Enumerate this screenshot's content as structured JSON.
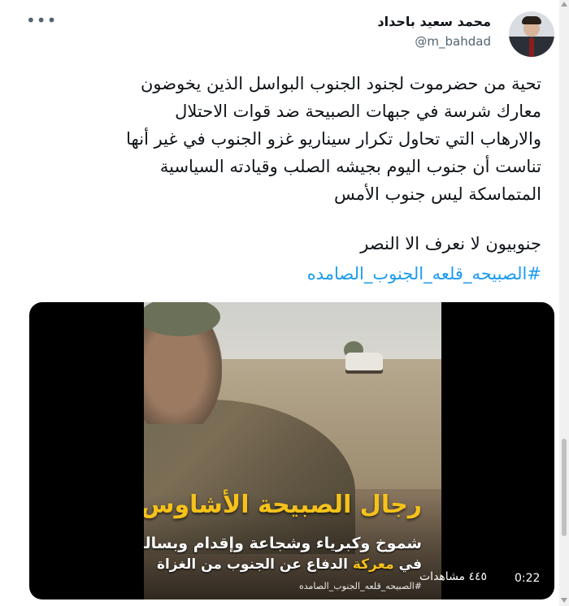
{
  "tweet": {
    "author": {
      "name": "محمد سعيد باحداد",
      "handle": "@m_bahdad"
    },
    "more_icon": "more-horizontal-icon",
    "text_lines": [
      "تحية من حضرموت لجنود الجنوب البواسل الذين يخوضون",
      "معارك شرسة في جبهات الصبيحة ضد قوات الاحتلال",
      "والارهاب التي تحاول تكرار سيناريو غزو الجنوب في غير أنها",
      "تناست أن جنوب اليوم بجيشه الصلب وقيادته السياسية",
      "المتماسكة ليس جنوب الأمس"
    ],
    "line2": "جنوبيون لا نعرف الا النصر",
    "hashtag": "#الصبيحه_قلعه_الجنوب_الصامده",
    "video": {
      "overlay_title": "رجال الصبيحة الأشاوس",
      "overlay_sub1": "شموخ وكبرياء وشجاعة وإقدام وبسالة",
      "overlay_sub2_prefix": "في",
      "overlay_sub2_highlight": "معركة",
      "overlay_sub2_rest": "الدفاع عن الجنوب من الغزاة",
      "overlay_tag": "#الصبيحه_قلعه_الجنوب_الصامده",
      "views": "٤٤٥ مشاهدات",
      "duration": "0:22"
    }
  },
  "colors": {
    "link": "#1d9bf0",
    "text": "#0f1419",
    "muted": "#536471",
    "overlay_yellow": "#f6c21a"
  }
}
